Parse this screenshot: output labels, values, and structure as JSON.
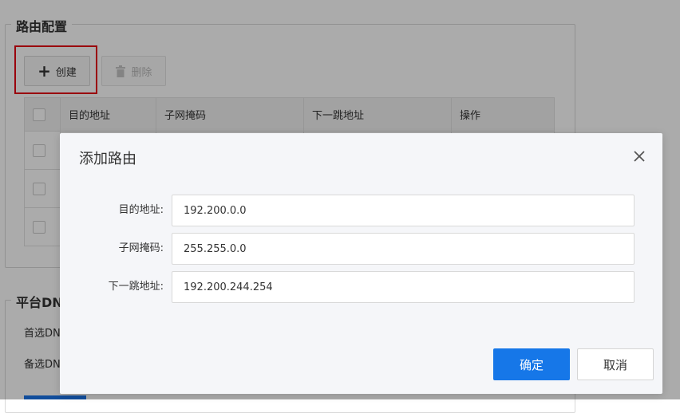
{
  "route_section": {
    "legend": "路由配置",
    "create_label": "创建",
    "delete_label": "删除",
    "table": {
      "headers": [
        "目的地址",
        "子网掩码",
        "下一跳地址",
        "操作"
      ],
      "rows": [
        [
          "",
          "",
          "",
          ""
        ],
        [
          "",
          "",
          "",
          ""
        ],
        [
          "",
          "",
          "",
          ""
        ]
      ]
    }
  },
  "dns_section": {
    "legend": "平台DN",
    "primary_label": "首选DN",
    "secondary_label": "备选DN"
  },
  "modal": {
    "title": "添加路由",
    "fields": [
      {
        "label": "目的地址:",
        "value": "192.200.0.0"
      },
      {
        "label": "子网掩码:",
        "value": "255.255.0.0"
      },
      {
        "label": "下一跳地址:",
        "value": "192.200.244.254"
      }
    ],
    "confirm_label": "确定",
    "cancel_label": "取消",
    "close_icon": "close-icon"
  },
  "colors": {
    "primary": "#1677e8",
    "highlight": "#e60012"
  }
}
